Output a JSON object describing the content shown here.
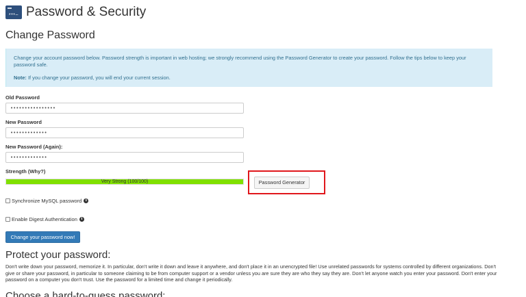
{
  "header": {
    "icon_text": "***~",
    "title": "Password & Security"
  },
  "change_password": {
    "title": "Change Password",
    "info_text": "Change your account password below. Password strength is important in web hosting; we strongly recommend using the Password Generator to create your password. Follow the tips below to keep your password safe.",
    "note_label": "Note:",
    "note_text": " If you change your password, you will end your current session."
  },
  "form": {
    "old_password_label": "Old Password",
    "old_password_value": "••••••••••••••••",
    "new_password_label": "New Password",
    "new_password_value": "•••••••••••••",
    "new_password_again_label": "New Password (Again):",
    "new_password_again_value": "•••••••••••••",
    "strength_label": "Strength (Why?)",
    "strength_text": "Very Strong (100/100)",
    "strength_percent": 100,
    "generator_button": "Password Generator",
    "sync_mysql_label": "Synchronize MySQL password",
    "digest_auth_label": "Enable Digest Authentication",
    "submit_button": "Change your password now!"
  },
  "protect": {
    "title": "Protect your password:",
    "text": "Don't write down your password, memorize it. In particular, don't write it down and leave it anywhere, and don't place it in an unencrypted file! Use unrelated passwords for systems controlled by different organizations. Don't give or share your password, in particular to someone claiming to be from computer support or a vendor unless you are sure they are who they say they are. Don't let anyone watch you enter your password. Don't enter your password on a computer you don't trust. Use the password for a limited time and change it periodically."
  },
  "choose": {
    "title": "Choose a hard-to-guess password:"
  },
  "colors": {
    "accent": "#337ab7",
    "info_bg": "#d9edf7",
    "strength": "#80e000",
    "highlight": "#e0161b"
  }
}
